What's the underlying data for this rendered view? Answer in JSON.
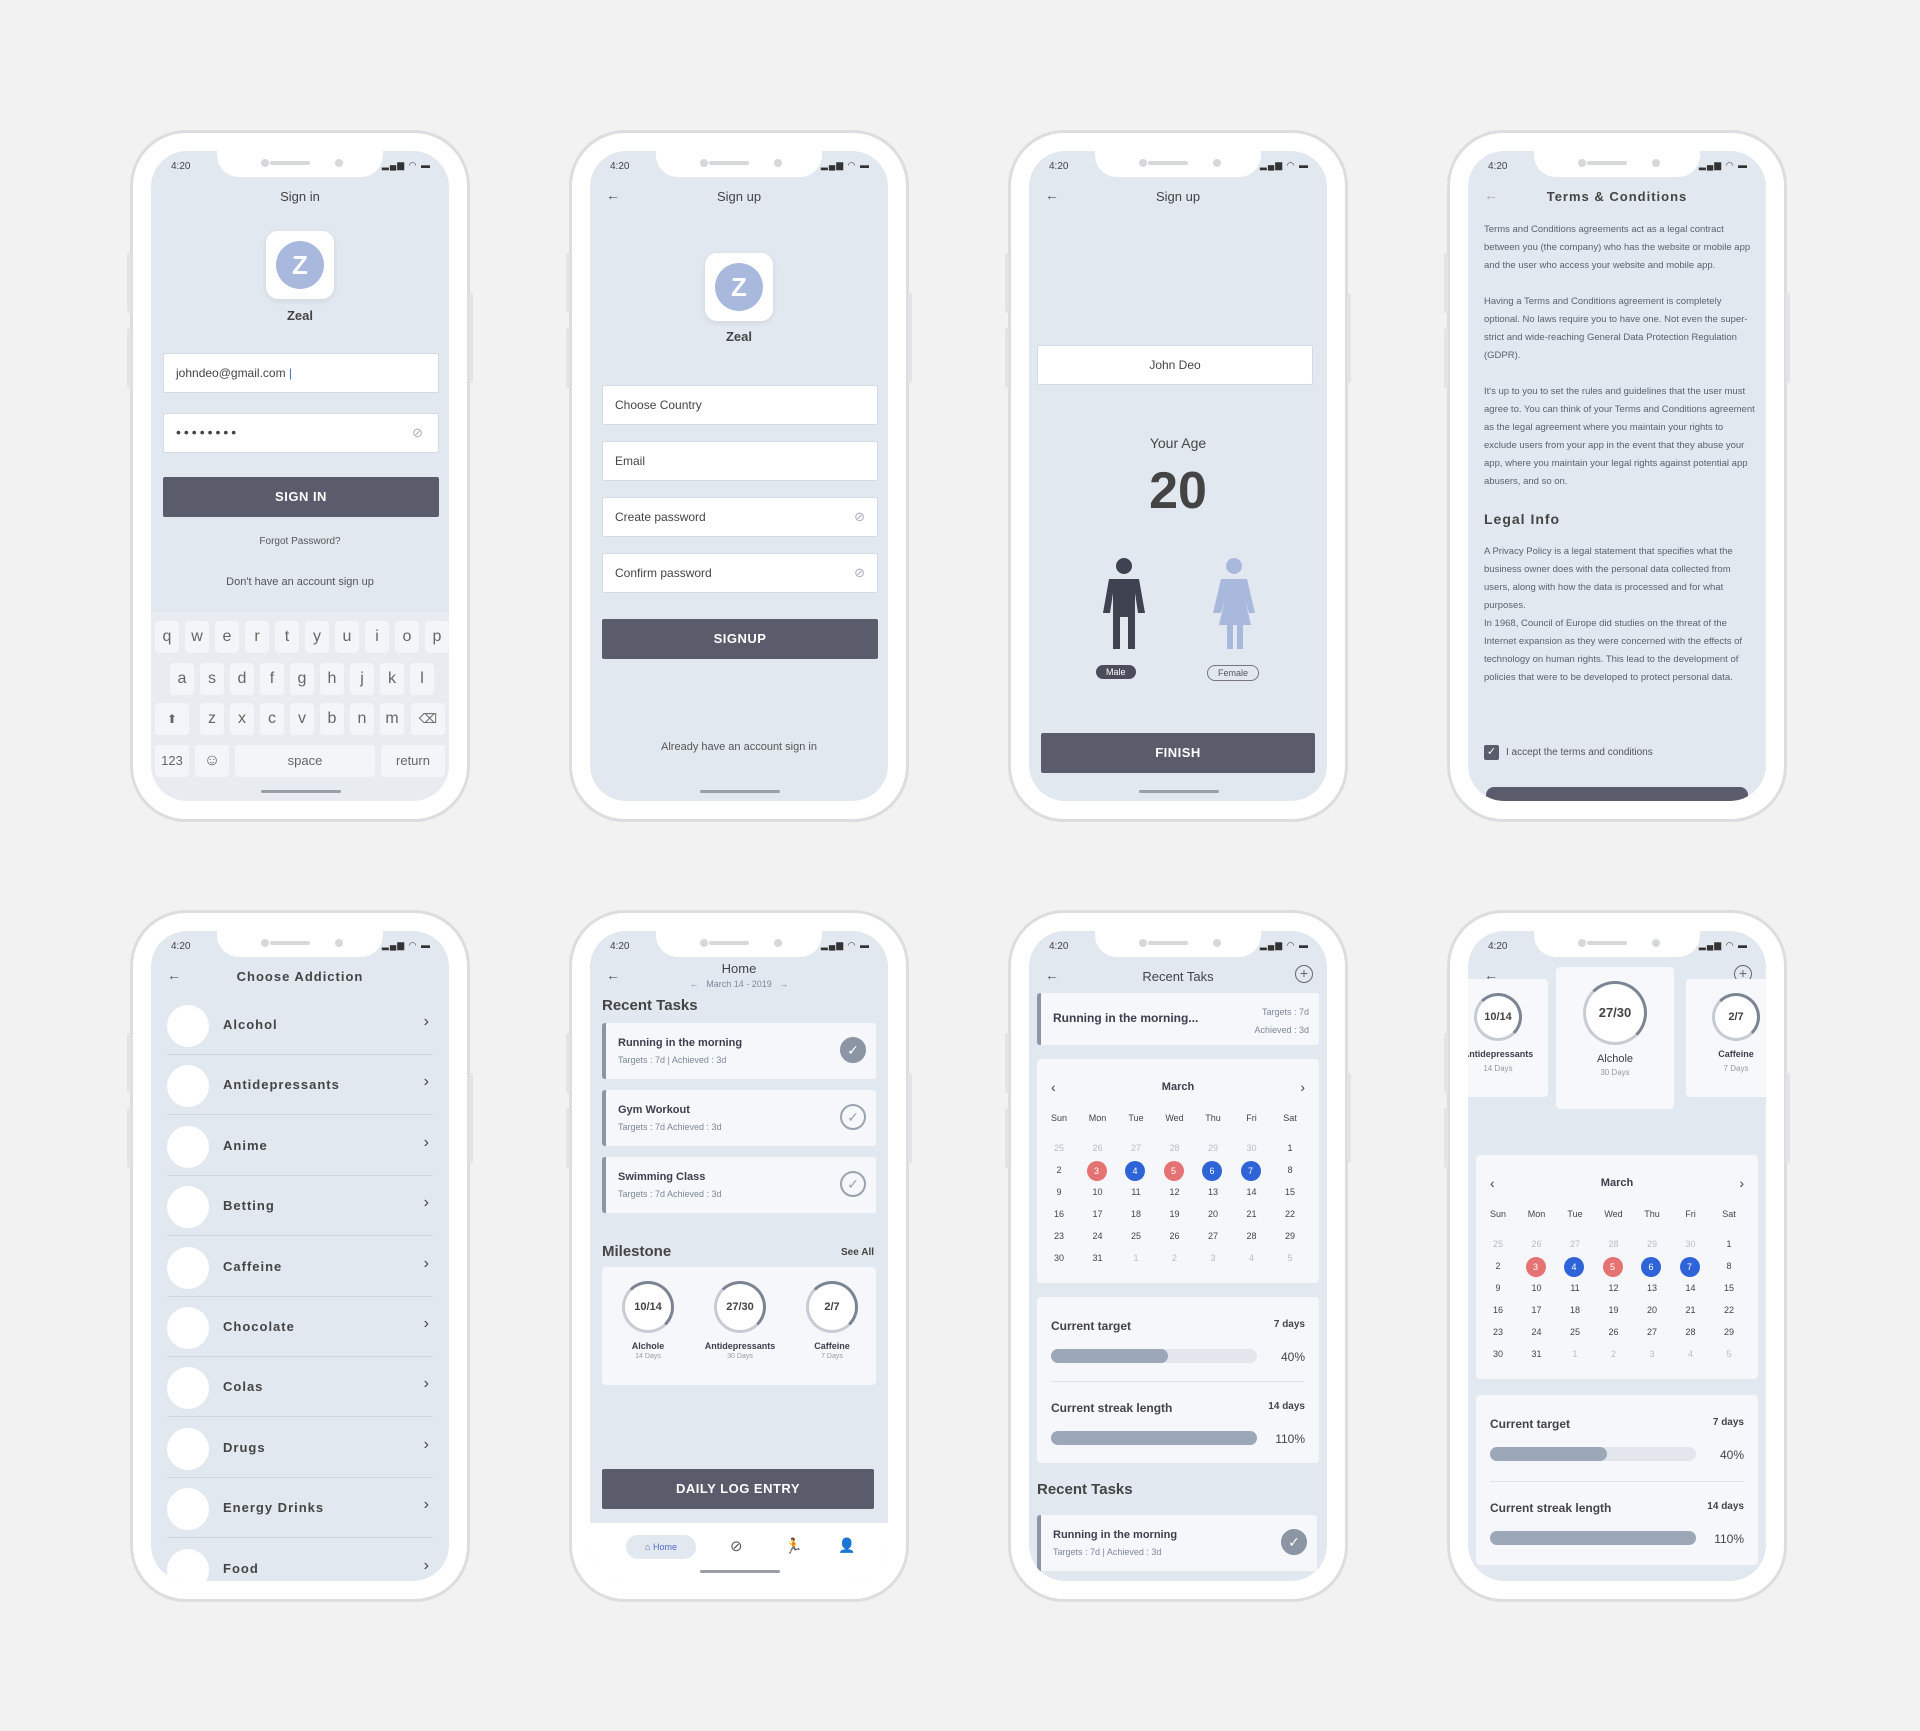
{
  "status": {
    "time": "4:20",
    "icons": "▂▄▆ ◠ ▬"
  },
  "signin": {
    "title": "Sign in",
    "logo_letter": "Z",
    "app_name": "Zeal",
    "email": "johndeo@gmail.com",
    "password": "••••••••",
    "button": "SIGN IN",
    "forgot": "Forgot Password?",
    "signup_link": "Don't have an account sign up",
    "kb_row1": [
      "q",
      "w",
      "e",
      "r",
      "t",
      "y",
      "u",
      "i",
      "o",
      "p"
    ],
    "kb_row2": [
      "a",
      "s",
      "d",
      "f",
      "g",
      "h",
      "j",
      "k",
      "l"
    ],
    "kb_row3": [
      "z",
      "x",
      "c",
      "v",
      "b",
      "n",
      "m"
    ],
    "kb_123": "123",
    "kb_space": "space",
    "kb_return": "return"
  },
  "signup": {
    "title": "Sign up",
    "logo_letter": "Z",
    "app_name": "Zeal",
    "country": "Choose Country",
    "email": "Email",
    "create_pw": "Create password",
    "confirm_pw": "Confirm password",
    "button": "SIGNUP",
    "signin_link": "Already have an account sign in"
  },
  "signup2": {
    "title": "Sign up",
    "name": "John Deo",
    "age_label": "Your Age",
    "age": "20",
    "male": "Male",
    "female": "Female",
    "button": "FINISH"
  },
  "terms": {
    "title": "Terms & Conditions",
    "p1": "Terms and Conditions agreements act as a legal contract between you (the company) who has the website or mobile app and the user who access your website and mobile app.",
    "p2": "Having a Terms and Conditions agreement is completely optional. No laws require you to have one. Not even the super-strict and wide-reaching General Data Protection Regulation (GDPR).",
    "p3": "It's up to you to set the rules and guidelines that the user must agree to. You can think of your Terms and Conditions agreement as the legal agreement where you maintain your rights to exclude users from your app in the event that they abuse your app, where you maintain your legal rights against potential app abusers, and so on.",
    "legal_title": "Legal Info",
    "p4": "A Privacy Policy is a legal statement that specifies what the business owner does with the personal data collected from users, along with how the data is processed and for what purposes.",
    "p5": "In 1968, Council of Europe did studies on the threat of the Internet expansion as they were concerned with the effects of technology on human rights. This lead to the development of policies that were to be developed to protect personal data.",
    "accept": "I accept the terms and conditions"
  },
  "addiction": {
    "title": "Choose Addiction",
    "items": [
      "Alcohol",
      "Antidepressants",
      "Anime",
      "Betting",
      "Caffeine",
      "Chocolate",
      "Colas",
      "Drugs",
      "Energy Drinks",
      "Food"
    ]
  },
  "home": {
    "title": "Home",
    "date": "March 14 - 2019",
    "recent": "Recent Tasks",
    "tasks": [
      {
        "name": "Running in the morning",
        "meta": "Targets :  7d   |   Achieved :  3d"
      },
      {
        "name": "Gym Workout",
        "meta": "Targets :  7d      Achieved :  3d"
      },
      {
        "name": "Swimming Class",
        "meta": "Targets :  7d      Achieved :  3d"
      }
    ],
    "milestone": "Milestone",
    "see_all": "See All",
    "m": [
      {
        "v": "10/14",
        "n": "Alchole",
        "d": "14 Days"
      },
      {
        "v": "27/30",
        "n": "Antidepressants",
        "d": "30 Days"
      },
      {
        "v": "2/7",
        "n": "Caffeine",
        "d": "7 Days"
      }
    ],
    "daily": "DAILY LOG ENTRY",
    "nav_home": "Home"
  },
  "recent": {
    "title": "Recent Taks",
    "task": "Running in the morning...",
    "targets": "Targets :  7d",
    "achieved": "Achieved :  3d",
    "month": "March",
    "days": [
      "Sun",
      "Mon",
      "Tue",
      "Wed",
      "Thu",
      "Fri",
      "Sat"
    ],
    "cur_target": "Current target",
    "cur_target_days": "7 days",
    "cur_target_pct": "40%",
    "cur_target_fill": 0.57,
    "streak": "Current streak length",
    "streak_days": "14 days",
    "streak_pct": "110%",
    "streak_fill": 1.0,
    "recent_tasks": "Recent Tasks",
    "task2": "Running in the morning",
    "task2_meta": "Targets :  7d   |   Achieved :  3d"
  },
  "alchole": {
    "title": "Alchole",
    "cards": [
      {
        "v": "10/14",
        "n": "Antidepressants",
        "d": "14 Days"
      },
      {
        "v": "27/30",
        "n": "Alchole",
        "d": "30 Days"
      },
      {
        "v": "2/7",
        "n": "Caffeine",
        "d": "7 Days"
      }
    ],
    "month": "March",
    "cur_target": "Current target",
    "cur_target_days": "7 days",
    "cur_target_pct": "40%",
    "streak": "Current streak length",
    "streak_days": "14 days",
    "streak_pct": "110%"
  },
  "calendar": {
    "weeks": [
      [
        "25",
        "26",
        "27",
        "28",
        "29",
        "30",
        "1"
      ],
      [
        "2",
        "3",
        "4",
        "5",
        "6",
        "7",
        "8"
      ],
      [
        "9",
        "10",
        "11",
        "12",
        "13",
        "14",
        "15"
      ],
      [
        "16",
        "17",
        "18",
        "19",
        "20",
        "21",
        "22"
      ],
      [
        "23",
        "24",
        "25",
        "26",
        "27",
        "28",
        "29"
      ],
      [
        "30",
        "31",
        "1",
        "2",
        "3",
        "4",
        "5"
      ]
    ]
  }
}
